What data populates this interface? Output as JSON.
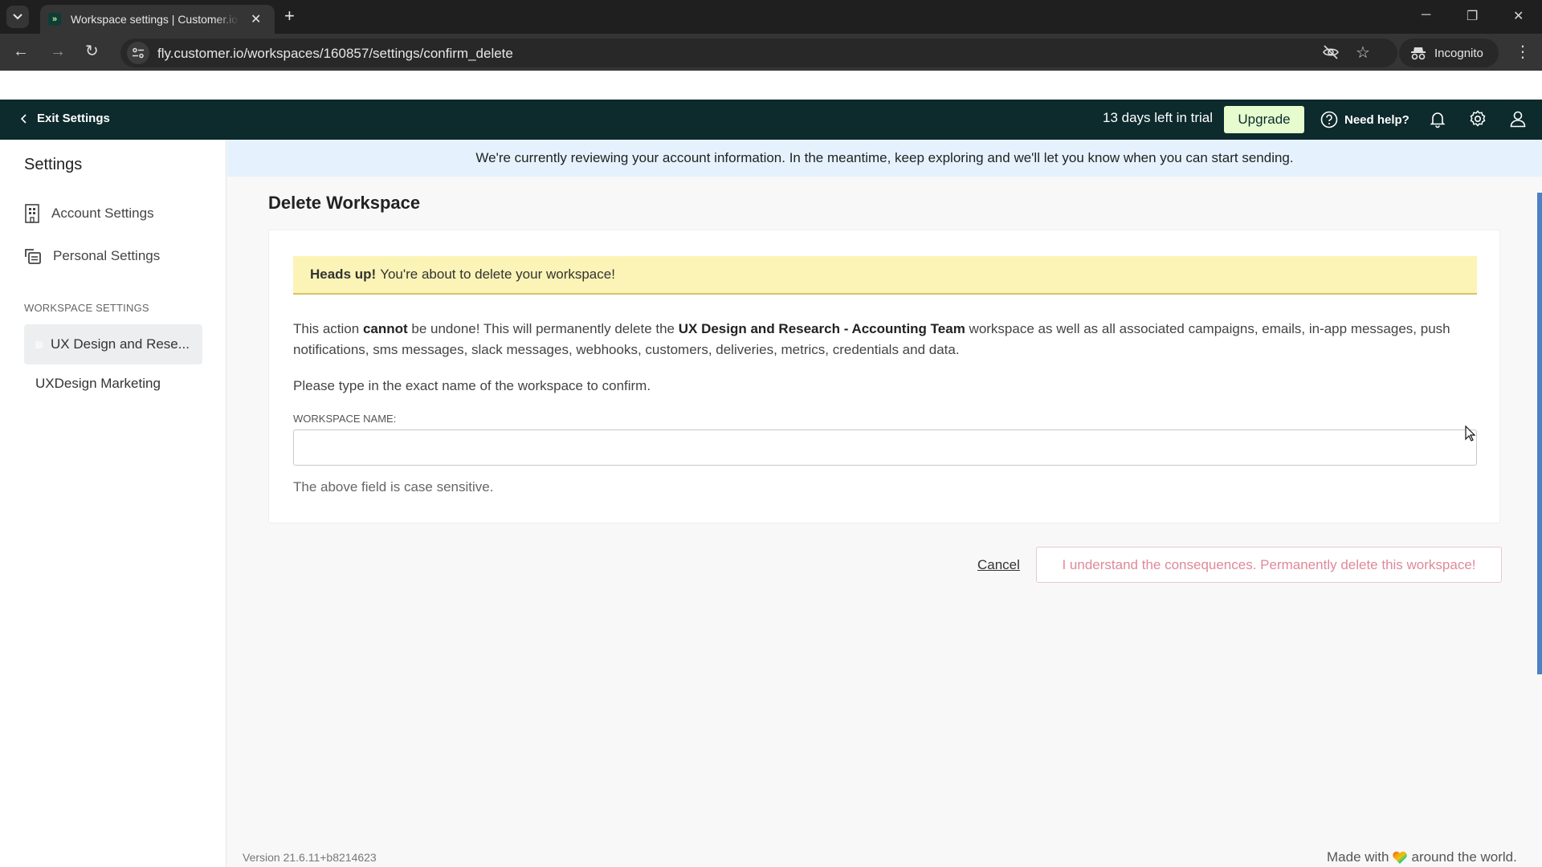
{
  "browser": {
    "tab_title": "Workspace settings | Customer.io",
    "favicon_glyph": "»",
    "url": "fly.customer.io/workspaces/160857/settings/confirm_delete",
    "incognito_label": "Incognito",
    "icons": {
      "tab_menu": "chevron-down-icon",
      "close_tab": "close-icon",
      "new_tab": "plus-icon",
      "back": "arrow-left-icon",
      "forward": "arrow-right-icon",
      "reload": "reload-icon",
      "site_info": "tune-icon",
      "tracking": "eye-off-icon",
      "bookmark": "star-icon",
      "menu": "kebab-icon",
      "minimize": "minimize-icon",
      "restore": "restore-icon",
      "close_window": "close-icon"
    }
  },
  "header": {
    "exit_label": "Exit Settings",
    "trial_text": "13 days left in trial",
    "upgrade_label": "Upgrade",
    "help_label": "Need help?",
    "accent_color": "#e6fccf",
    "background_color": "#0d2a2d"
  },
  "sidebar": {
    "title": "Settings",
    "items": [
      {
        "label": "Account Settings",
        "icon": "building-icon"
      },
      {
        "label": "Personal Settings",
        "icon": "cards-icon"
      }
    ],
    "section_label": "WORKSPACE SETTINGS",
    "workspaces": [
      {
        "label": "UX Design and Rese...",
        "active": true
      },
      {
        "label": "UXDesign Marketing",
        "active": false
      }
    ]
  },
  "banner": {
    "text": "We're currently reviewing your account information. In the meantime, keep exploring and we'll let you know when you can start sending."
  },
  "main": {
    "title": "Delete Workspace",
    "alert": {
      "strong": "Heads up!",
      "text": "You're about to delete your workspace!"
    },
    "description": {
      "part1": "This action ",
      "bold1": "cannot",
      "part2": " be undone! This will permanently delete the ",
      "workspace_name": "UX Design and Research - Accounting Team",
      "part3": " workspace as well as all associated campaigns, emails, in-app messages, push notifications, sms messages, slack messages, webhooks, customers, deliveries, metrics, credentials and data."
    },
    "prompt": "Please type in the exact name of the workspace to confirm.",
    "field_label": "WORKSPACE NAME:",
    "field_value": "",
    "field_placeholder": "",
    "hint": "The above field is case sensitive.",
    "cancel_label": "Cancel",
    "delete_label": "I understand the consequences. Permanently delete this workspace!"
  },
  "footer": {
    "version": "Version 21.6.11+b8214623",
    "made_with_pre": "Made with",
    "made_with_post": "around the world."
  }
}
